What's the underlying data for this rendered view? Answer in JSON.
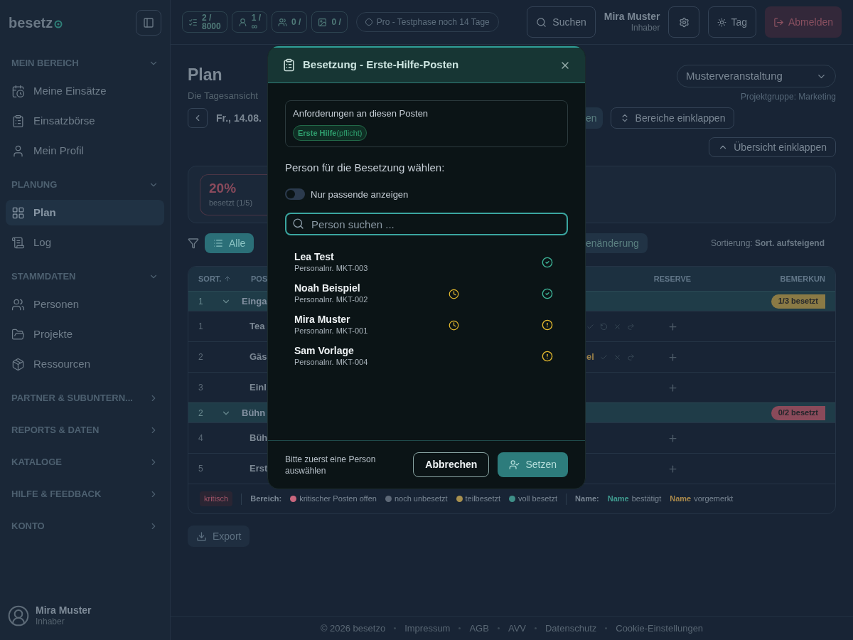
{
  "sidebar": {
    "logo": "besetz",
    "sections": [
      {
        "title": "MEIN BEREICH",
        "expanded": true,
        "items": [
          {
            "label": "Meine Einsätze",
            "selected": false
          },
          {
            "label": "Einsatzbörse",
            "selected": false
          },
          {
            "label": "Mein Profil",
            "selected": false
          }
        ]
      },
      {
        "title": "PLANUNG",
        "expanded": true,
        "items": [
          {
            "label": "Plan",
            "selected": true
          },
          {
            "label": "Log",
            "selected": false
          }
        ]
      },
      {
        "title": "STAMMDATEN",
        "expanded": true,
        "items": [
          {
            "label": "Personen",
            "selected": false
          },
          {
            "label": "Projekte",
            "selected": false
          },
          {
            "label": "Ressourcen",
            "selected": false
          }
        ]
      },
      {
        "title": "PARTNER & SUBUNTERN...",
        "expanded": false
      },
      {
        "title": "REPORTS & DATEN",
        "expanded": false
      },
      {
        "title": "KATALOGE",
        "expanded": false
      },
      {
        "title": "HILFE & FEEDBACK",
        "expanded": false
      },
      {
        "title": "KONTO",
        "expanded": false
      }
    ],
    "user": {
      "name": "Mira Muster",
      "role": "Inhaber"
    }
  },
  "topbar": {
    "counters": [
      {
        "value": "2 /",
        "limit": "8000"
      },
      {
        "value": "1 /",
        "limit": "∞"
      },
      {
        "value": "0 /"
      },
      {
        "value": "0 /"
      }
    ],
    "trial": "Pro - Testphase noch 14 Tage",
    "search": "Suchen",
    "user": {
      "name": "Mira Muster",
      "role": "Inhaber"
    },
    "theme": "Tag",
    "logout": "Abmelden"
  },
  "page": {
    "title": "Plan",
    "subtitle": "Die Tagesansicht",
    "date": "Fr., 14.08.",
    "date_action": "en",
    "collapse_areas": "Bereiche einklappen",
    "project": "Musterveranstaltung",
    "project_group": "Projektgruppe: Marketing",
    "collapse_overview": "Übersicht einklappen",
    "stats": {
      "percent": "20%",
      "label": "besetzt (1/5)"
    },
    "filters": [
      {
        "label": "Alle",
        "selected": true
      },
      {
        "label": "enänderung",
        "selected": false
      }
    ],
    "sorting": "Sortierung: **Sort. aufsteigend**"
  },
  "table": {
    "columns": {
      "sort": "SORT.",
      "pos": "POS",
      "reserve": "RESERVE",
      "remark": "BEMERKUN"
    },
    "rows": [
      {
        "kind": "group",
        "number": "1",
        "name": "Einga",
        "badge": "1/3 besetzt",
        "color": "#8a7a45"
      },
      {
        "kind": "post",
        "number": "1",
        "name": "Tea",
        "assigned": true
      },
      {
        "kind": "post",
        "number": "2",
        "name": "Gäs",
        "assignee": "el",
        "assigned": true
      },
      {
        "kind": "post",
        "number": "3",
        "name": "Einl",
        "assigned": false
      },
      {
        "kind": "group",
        "number": "2",
        "name": "Bühn",
        "badge": "0/2 besetzt",
        "color": "#8a4a5a"
      },
      {
        "kind": "post",
        "number": "4",
        "name": "Büh",
        "assigned": false
      },
      {
        "kind": "post",
        "number": "5",
        "name": "Erst",
        "assigned": false
      }
    ],
    "legend": {
      "critical": "kritisch",
      "area_label": "Bereich:",
      "areas": [
        {
          "label": "kritischer Posten offen",
          "color": "#c9677e"
        },
        {
          "label": "noch unbesetzt",
          "color": "#5d6877"
        },
        {
          "label": "teilbesetzt",
          "color": "#a8904f"
        },
        {
          "label": "voll besetzt",
          "color": "#3f8f88"
        }
      ],
      "name_label": "Name:",
      "names": [
        {
          "sample": "Name",
          "label": "bestätigt",
          "color": "#3f9a8f"
        },
        {
          "sample": "Name",
          "label": "vorgemerkt",
          "color": "#a8884a"
        }
      ]
    }
  },
  "export": "Export",
  "footer": [
    "© 2026 besetzo",
    "Impressum",
    "AGB",
    "AVV",
    "Datenschutz",
    "Cookie-Einstellungen"
  ],
  "modal": {
    "title": "Besetzung - Erste-Hilfe-Posten",
    "requirements_label": "Anforderungen an diesen Posten",
    "requirements": [
      "**Erste Hilfe**(pflicht)"
    ],
    "choose_label": "Person für die Besetzung wählen:",
    "only_matching": {
      "label": "Nur passende anzeigen",
      "on": false
    },
    "search_placeholder": "Person suchen ...",
    "persons": [
      {
        "name": "Lea Test",
        "id": "Personalnr. MKT-003",
        "clock": false,
        "kind": "ok"
      },
      {
        "name": "Noah Beispiel",
        "id": "Personalnr. MKT-002",
        "clock": true,
        "kind": "ok"
      },
      {
        "name": "Mira Muster",
        "id": "Personalnr. MKT-001",
        "clock": true,
        "kind": "warning"
      },
      {
        "name": "Sam Vorlage",
        "id": "Personalnr. MKT-004",
        "clock": false,
        "kind": "warning"
      }
    ],
    "hint": "Bitte zuerst eine Person auswählen",
    "cancel": "Abbrechen",
    "confirm": {
      "label": "Setzen",
      "disabled": true
    }
  }
}
